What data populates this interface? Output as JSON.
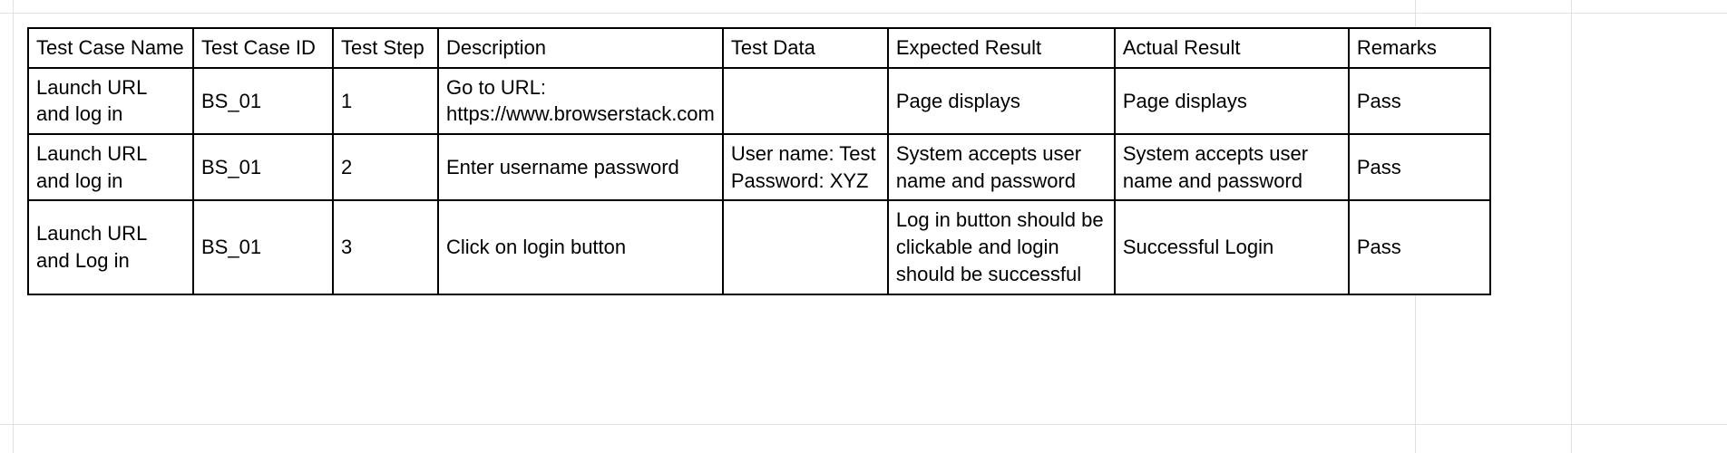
{
  "table": {
    "headers": [
      "Test Case Name",
      "Test Case ID",
      "Test Step",
      "Description",
      "Test Data",
      "Expected Result",
      "Actual Result",
      "Remarks"
    ],
    "rows": [
      {
        "name": "Launch URL and log in",
        "id": "BS_01",
        "step": "1",
        "description": "Go to URL: https://www.browserstack.com",
        "data": "",
        "expected": "Page displays",
        "actual": "Page displays",
        "remarks": "Pass"
      },
      {
        "name": "Launch URL and log in",
        "id": "BS_01",
        "step": "2",
        "description": "Enter username password",
        "data": "User name: Test\nPassword: XYZ",
        "expected": "System accepts user name and password",
        "actual": "System accepts user name and password",
        "remarks": "Pass"
      },
      {
        "name": "Launch URL and Log in",
        "id": "BS_01",
        "step": "3",
        "description": "Click on login button",
        "data": "",
        "expected": "Log in button should be clickable and login should be successful",
        "actual": "Successful Login",
        "remarks": "Pass"
      }
    ]
  }
}
